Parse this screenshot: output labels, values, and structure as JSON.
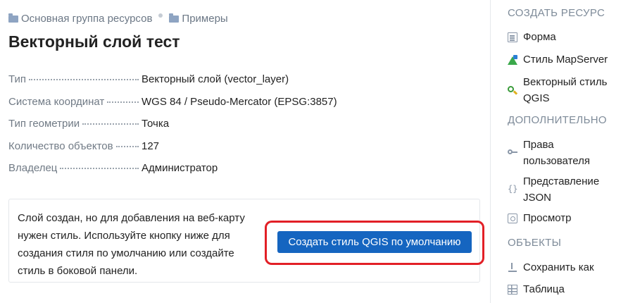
{
  "breadcrumb": {
    "items": [
      "Основная группа ресурсов",
      "Примеры"
    ]
  },
  "page": {
    "title": "Векторный слой тест"
  },
  "properties": [
    {
      "key": "Тип",
      "value": "Векторный слой (vector_layer)"
    },
    {
      "key": "Система координат",
      "value": "WGS 84 / Pseudo-Mercator (EPSG:3857)"
    },
    {
      "key": "Тип геометрии",
      "value": "Точка"
    },
    {
      "key": "Количество объектов",
      "value": "127"
    },
    {
      "key": "Владелец",
      "value": "Администратор"
    }
  ],
  "notice": {
    "text": "Слой создан, но для добавления на веб-карту нужен стиль. Используйте кнопку ниже для создания стиля по умолчанию или создайте стиль в боковой панели.",
    "button_label": "Создать стиль QGIS по умолчанию",
    "highlight_color": "#e21f26",
    "button_color": "#1565c0"
  },
  "sidebar": {
    "create_title": "СОЗДАТЬ РЕСУРС",
    "create_items": [
      {
        "label": "Форма",
        "icon": "form-icon"
      },
      {
        "label": "Стиль MapServer",
        "icon": "mapserver-icon"
      },
      {
        "label": "Векторный стиль QGIS",
        "icon": "qgis-icon"
      }
    ],
    "extra_title": "ДОПОЛНИТЕЛЬНО",
    "extra_items": [
      {
        "label": "Права пользователя",
        "icon": "key-icon"
      },
      {
        "label": "Представление JSON",
        "icon": "json-icon"
      },
      {
        "label": "Просмотр",
        "icon": "view-icon"
      }
    ],
    "objects_title": "ОБЪЕКТЫ",
    "objects_items": [
      {
        "label": "Сохранить как",
        "icon": "download-icon"
      },
      {
        "label": "Таблица",
        "icon": "table-icon"
      }
    ]
  }
}
